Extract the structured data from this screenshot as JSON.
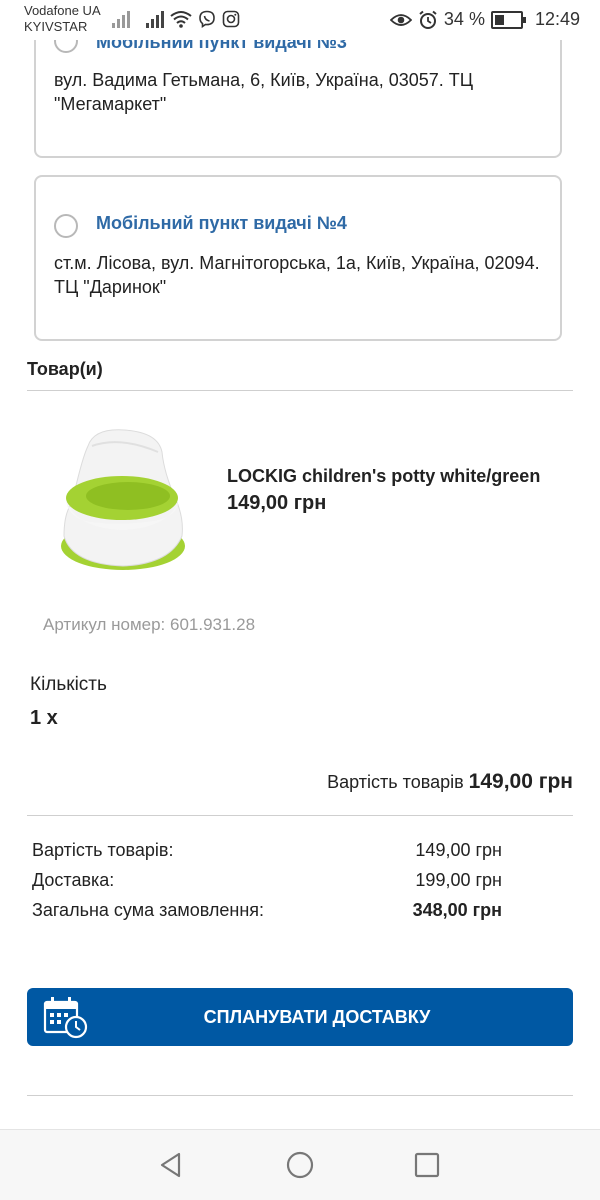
{
  "status_bar": {
    "carrier_line1": "Vodafone UA",
    "carrier_line2": "KYIVSTAR",
    "battery_percent": "34 %",
    "time": "12:49"
  },
  "pickup_points": [
    {
      "title": "Мобільний пункт видачі №3",
      "address": "вул. Вадима Гетьмана, 6, Київ, Україна, 03057. ТЦ \"Мегамаркет\"",
      "selected": false
    },
    {
      "title": "Мобільний пункт видачі №4",
      "address": "ст.м. Лісова, вул. Магнітогорська, 1а, Київ, Україна, 02094. ТЦ \"Даринок\"",
      "selected": false
    }
  ],
  "products_section": {
    "title": "Товар(и)",
    "product": {
      "name": "LOCKIG children's potty white/green",
      "price": "149,00 грн",
      "article": "Артикул номер: 601.931.28",
      "quantity_label": "Кількість",
      "quantity_value": "1 x",
      "image_icon": "potty-product-image",
      "image_colors": {
        "body": "#f2f2f2",
        "accent": "#a4d233"
      }
    },
    "items_cost_label": "Вартість товарів",
    "items_cost_value": "149,00 грн"
  },
  "summary": {
    "rows": [
      {
        "label": "Вартість товарів:",
        "value": "149,00 грн"
      },
      {
        "label": "Доставка:",
        "value": "199,00 грн"
      },
      {
        "label": "Загальна сума замовлення:",
        "value": "348,00 грн"
      }
    ]
  },
  "plan_button": {
    "label": "СПЛАНУВАТИ ДОСТАВКУ",
    "icon": "calendar-clock-icon",
    "color": "#0058a3"
  },
  "nav_bar": {
    "back_icon": "back-triangle-icon",
    "home_icon": "home-circle-icon",
    "recents_icon": "recents-square-icon"
  },
  "colors": {
    "link_title": "#2f6aa6",
    "muted_text": "#9a9a9a",
    "card_border": "#d2d2d2"
  }
}
